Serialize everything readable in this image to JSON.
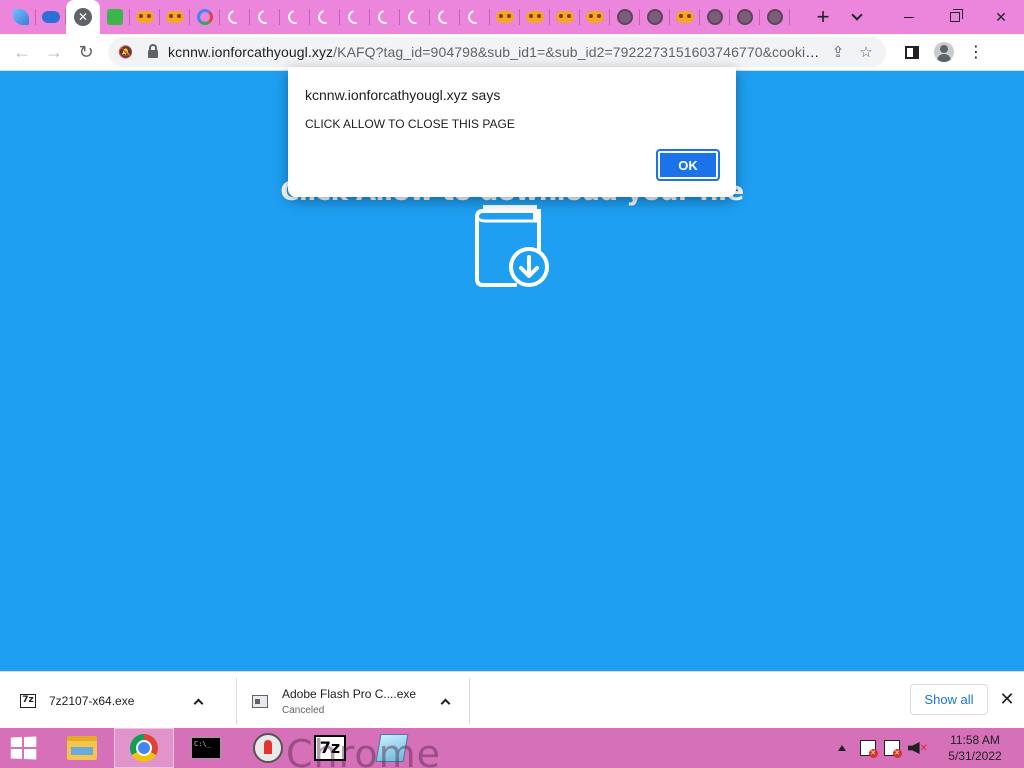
{
  "browser": {
    "tabs": [
      {
        "icon": "feather-icon"
      },
      {
        "icon": "controller-icon"
      },
      {
        "icon": "close-icon",
        "active": true
      },
      {
        "icon": "green-box-icon"
      },
      {
        "icon": "gamepad-icon"
      },
      {
        "icon": "gamepad-icon"
      },
      {
        "icon": "google-icon"
      },
      {
        "icon": "loading-spinner-icon"
      },
      {
        "icon": "loading-spinner-icon"
      },
      {
        "icon": "loading-spinner-icon"
      },
      {
        "icon": "loading-spinner-icon"
      },
      {
        "icon": "loading-spinner-icon"
      },
      {
        "icon": "loading-spinner-icon"
      },
      {
        "icon": "loading-spinner-icon"
      },
      {
        "icon": "loading-spinner-icon"
      },
      {
        "icon": "loading-spinner-icon"
      },
      {
        "icon": "gamepad-icon"
      },
      {
        "icon": "gamepad-icon"
      },
      {
        "icon": "gamepad-icon"
      },
      {
        "icon": "gamepad-icon"
      },
      {
        "icon": "globe-icon"
      },
      {
        "icon": "globe-icon"
      },
      {
        "icon": "gamepad-icon"
      },
      {
        "icon": "globe-icon"
      },
      {
        "icon": "globe-icon"
      },
      {
        "icon": "globe-icon"
      }
    ],
    "new_tab_glyph": "+",
    "url_host": "kcnnw.ionforcathyougl.xyz",
    "url_rest": "/KAFQ?tag_id=904798&sub_id1=&sub_id2=7922273151603746770&cookie_id=...",
    "tab_strip_color": "#ec85dc"
  },
  "page": {
    "headline": "Click Allow to download your file",
    "background_color": "#1e9ff2"
  },
  "alert": {
    "title": "kcnnw.ionforcathyougl.xyz says",
    "message": "CLICK ALLOW TO CLOSE THIS PAGE",
    "ok_label": "OK"
  },
  "downloads": {
    "items": [
      {
        "name": "7z2107-x64.exe",
        "status": "",
        "icon": "7z-icon"
      },
      {
        "name": "Adobe Flash Pro C....exe",
        "status": "Canceled",
        "icon": "app-window-icon"
      }
    ],
    "show_all_label": "Show all",
    "close_glyph": "✕"
  },
  "taskbar": {
    "apps": [
      {
        "name": "file-explorer",
        "icon": "folder-icon"
      },
      {
        "name": "chrome",
        "icon": "chrome-icon",
        "active": true
      },
      {
        "name": "command-prompt",
        "icon": "cmd-icon",
        "text": "C:\\_"
      },
      {
        "name": "java",
        "icon": "java-icon"
      },
      {
        "name": "7-zip",
        "icon": "7z-icon",
        "text": "7z"
      },
      {
        "name": "notepad",
        "icon": "notepad-icon"
      }
    ],
    "wallpaper_text": "Chrome",
    "time": "11:58 AM",
    "date": "5/31/2022",
    "color": "#d670b9"
  }
}
